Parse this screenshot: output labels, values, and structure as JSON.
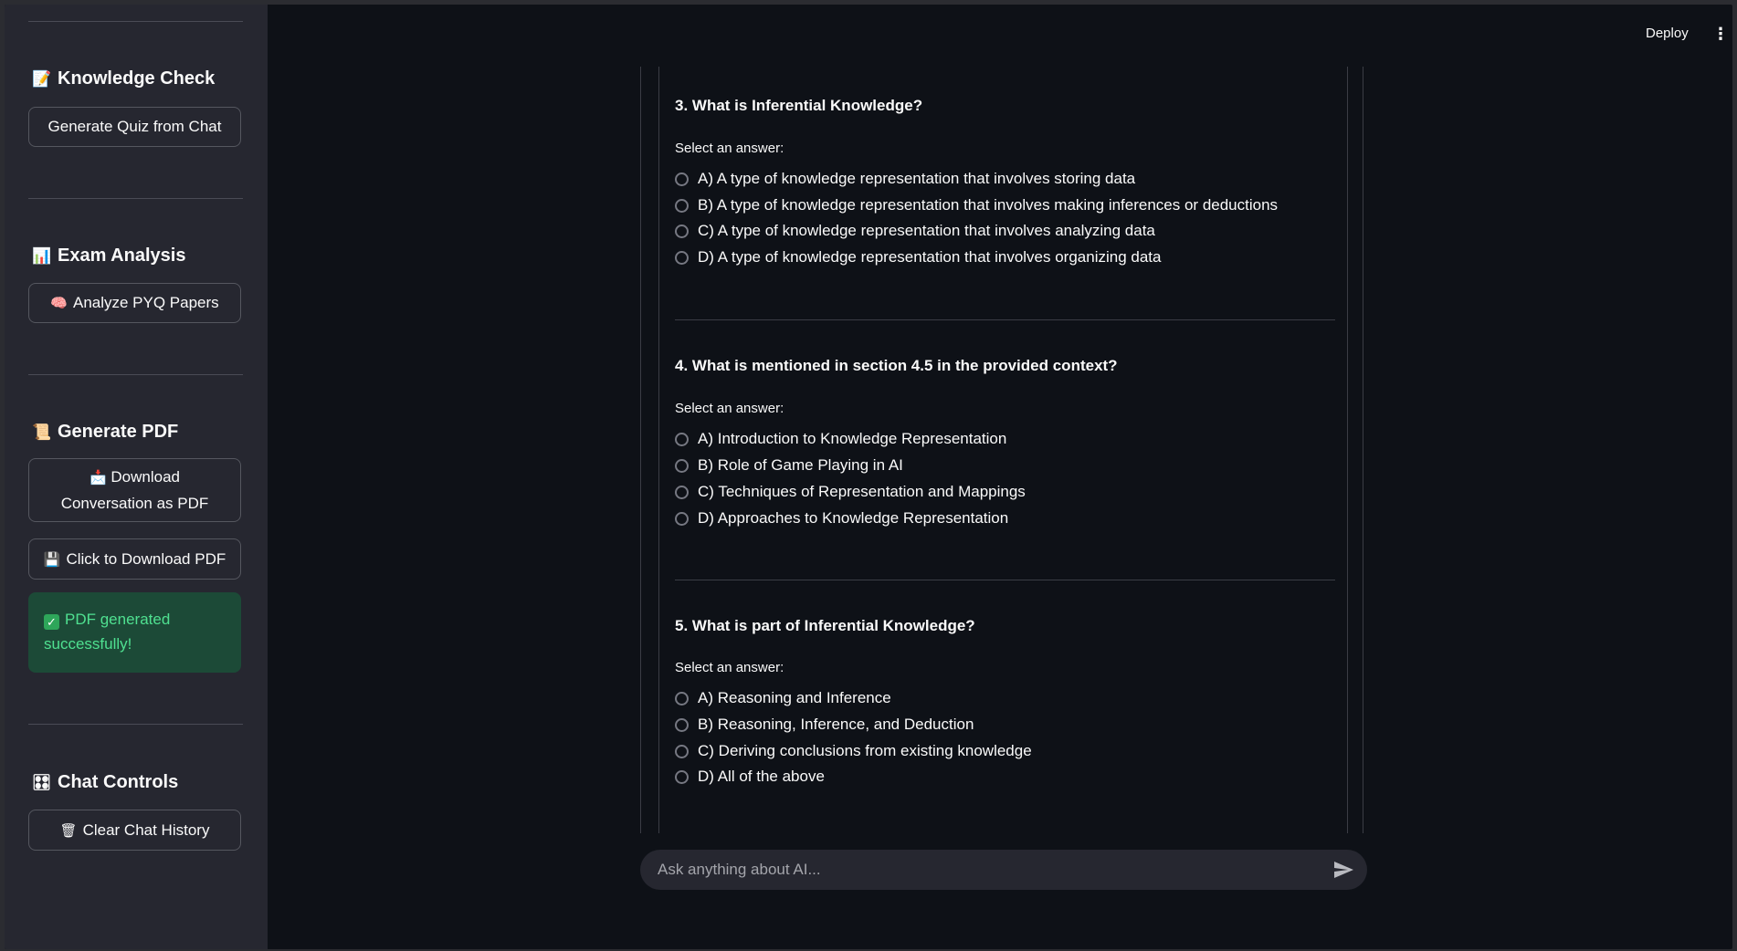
{
  "header": {
    "deploy_label": "Deploy",
    "menu_icon": "more-vertical-icon"
  },
  "sidebar": {
    "knowledge_check": {
      "icon": "memo-icon",
      "title": "Knowledge Check",
      "button": "Generate Quiz from Chat"
    },
    "exam_analysis": {
      "icon": "bar-chart-icon",
      "title": "Exam Analysis",
      "button_icon": "brain-icon",
      "button": "Analyze PYQ Papers"
    },
    "generate_pdf": {
      "icon": "scroll-icon",
      "title": "Generate PDF",
      "download_icon": "inbox-tray-icon",
      "download_line1": "Download",
      "download_line2": "Conversation as PDF",
      "click_icon": "floppy-disk-icon",
      "click_download": "Click to Download PDF",
      "success_line1": "PDF generated",
      "success_line2": "successfully!"
    },
    "chat_controls": {
      "icon": "control-knobs-icon",
      "title": "Chat Controls",
      "clear_icon": "wastebasket-icon",
      "clear_button": "Clear Chat History"
    }
  },
  "quiz": {
    "questions": [
      {
        "title": "3. What is Inferential Knowledge?",
        "select_label": "Select an answer:",
        "options": [
          "A) A type of knowledge representation that involves storing data",
          "B) A type of knowledge representation that involves making inferences or deductions",
          "C) A type of knowledge representation that involves analyzing data",
          "D) A type of knowledge representation that involves organizing data"
        ]
      },
      {
        "title": "4. What is mentioned in section 4.5 in the provided context?",
        "select_label": "Select an answer:",
        "options": [
          "A) Introduction to Knowledge Representation",
          "B) Role of Game Playing in AI",
          "C) Techniques of Representation and Mappings",
          "D) Approaches to Knowledge Representation"
        ]
      },
      {
        "title": "5. What is part of Inferential Knowledge?",
        "select_label": "Select an answer:",
        "options": [
          "A) Reasoning and Inference",
          "B) Reasoning, Inference, and Deduction",
          "C) Deriving conclusions from existing knowledge",
          "D) All of the above"
        ]
      }
    ]
  },
  "chat": {
    "placeholder": "Ask anything about AI...",
    "send_icon": "send-icon"
  },
  "colors": {
    "app_bg": "#0e1117",
    "sidebar_bg": "#262730",
    "success_bg": "#1c4a37",
    "success_text": "#4fe090"
  }
}
